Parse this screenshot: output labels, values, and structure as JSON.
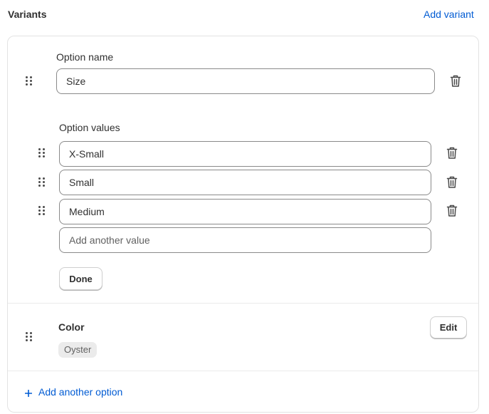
{
  "section": {
    "title": "Variants",
    "add_variant_label": "Add variant"
  },
  "option_size": {
    "name_label": "Option name",
    "name_value": "Size",
    "values_label": "Option values",
    "values": [
      "X-Small",
      "Small",
      "Medium"
    ],
    "new_value_placeholder": "Add another value",
    "done_label": "Done"
  },
  "option_color": {
    "name": "Color",
    "values": [
      "Oyster"
    ],
    "edit_label": "Edit"
  },
  "footer": {
    "add_option_label": "Add another option",
    "add_icon": "plus-icon"
  },
  "icons": {
    "drag": "drag-handle-icon",
    "delete": "trash-icon"
  },
  "colors": {
    "accent": "#005bd3",
    "border": "#8a8a8a",
    "text": "#303030"
  }
}
